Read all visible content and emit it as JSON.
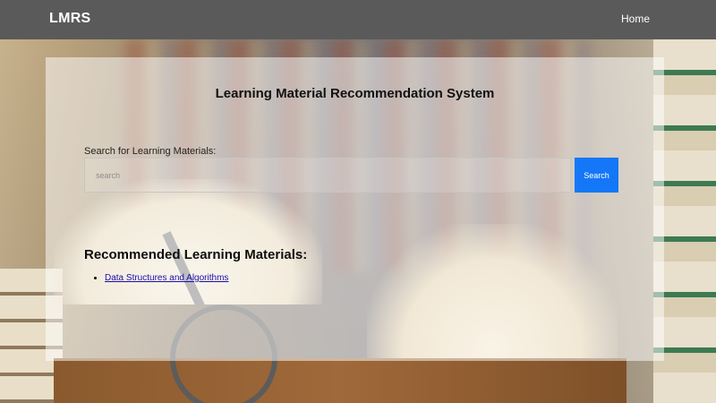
{
  "navbar": {
    "brand": "LMRS",
    "home_label": "Home"
  },
  "main": {
    "title": "Learning Material Recommendation System",
    "search": {
      "label": "Search for Learning Materials:",
      "placeholder": "search",
      "value": "",
      "button_label": "Search"
    },
    "recommendations": {
      "heading": "Recommended Learning Materials:",
      "items": [
        {
          "label": "Data Structures and Algorithms"
        }
      ]
    }
  },
  "colors": {
    "navbar_bg": "#5a5a5a",
    "search_button_bg": "#1477f8",
    "link": "#1a0dab"
  },
  "icons": {
    "list_bullet": "bullet-icon"
  }
}
